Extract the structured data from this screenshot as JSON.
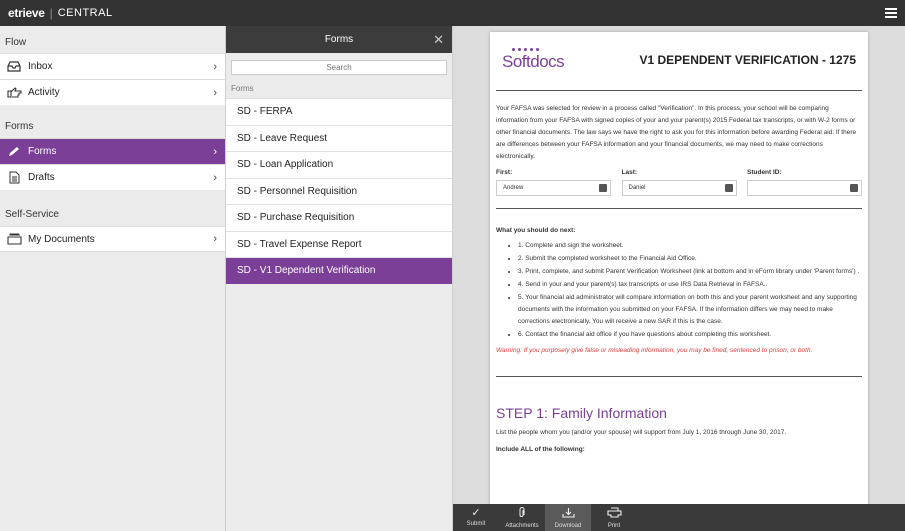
{
  "topbar": {
    "brand": "etrieve",
    "app": "CENTRAL"
  },
  "sidebar": {
    "flow_label": "Flow",
    "flow_items": [
      {
        "label": "Inbox",
        "icon": "inbox-icon"
      },
      {
        "label": "Activity",
        "icon": "hand-pointer-icon"
      }
    ],
    "forms_label": "Forms",
    "forms_items": [
      {
        "label": "Forms",
        "icon": "pencil-icon"
      },
      {
        "label": "Drafts",
        "icon": "document-icon"
      }
    ],
    "self_label": "Self-Service",
    "self_items": [
      {
        "label": "My Documents",
        "icon": "stack-icon"
      }
    ]
  },
  "forms_panel": {
    "title": "Forms",
    "search_placeholder": "Search",
    "list_label": "Forms",
    "items": [
      "SD - FERPA",
      "SD - Leave Request",
      "SD - Loan Application",
      "SD - Personnel Requisition",
      "SD - Purchase Requisition",
      "SD - Travel Expense Report",
      "SD - V1 Dependent Verification"
    ]
  },
  "document": {
    "logo_text": "Softdocs",
    "title": "V1 DEPENDENT VERIFICATION - 1275",
    "intro": "Your FAFSA was selected for review in a process called \"Verification\". In this process, your school will be comparing information from your FAFSA with signed copies of your and your parent(s) 2015 Federal tax transcripts, or with W-2 forms or other financial documents. The law says we have the right to ask you for this information before awarding Federal aid. If there are differences between your FAFSA information and your financial documents, we may need to make corrections electronically.",
    "fields": [
      {
        "label": "First:",
        "value": "Andrew"
      },
      {
        "label": "Last:",
        "value": "Daniel"
      },
      {
        "label": "Student ID:",
        "value": ""
      }
    ],
    "next_heading": "What you should do next:",
    "steps": [
      "1. Complete and sign the worksheet.",
      "2. Submit the completed worksheet to the Financial Aid Office.",
      "3. Print, complete, and submit Parent Verification Worksheet (link at bottom and in eForm library under 'Parent forms') .",
      "4. Send in your and your parent(s) tax transcripts or use IRS Data Retrieval in FAFSA..",
      "5. Your financial aid administrator will compare information on both this and your parent worksheet and any supporting documents with the information you submitted on your FAFSA. If the information differs we may need to make corrections electronically. You will receive a new SAR if this is the case.",
      "6. Contact the financial aid office if you have questions about completing this worksheet."
    ],
    "warning": "Warning: If you purposely give false or misleading information, you may be fined, sentenced to prison, or both.",
    "step1_heading": "STEP 1: Family Information",
    "people_text": "List the people whom you (and/or your spouse) will support from July 1, 2016 through June 30, 2017.",
    "include_text": "Include ALL of the following:"
  },
  "bottombar": {
    "buttons": [
      {
        "label": "Submit",
        "icon": "checkmark-icon"
      },
      {
        "label": "Attachments",
        "icon": "paperclip-icon"
      },
      {
        "label": "Download",
        "icon": "download-icon"
      },
      {
        "label": "Print",
        "icon": "printer-icon"
      }
    ]
  },
  "colors": {
    "accent": "#7b3f98",
    "topbar": "#323232",
    "warning": "#e23b3b"
  }
}
